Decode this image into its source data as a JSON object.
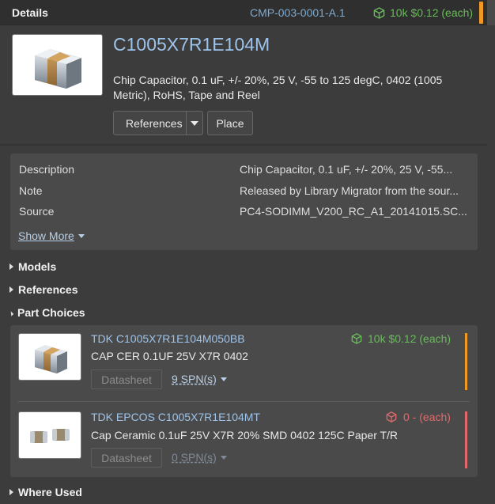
{
  "header": {
    "title": "Details",
    "part_number": "CMP-003-0001-A.1",
    "stock": "10k  $0.12 (each)"
  },
  "part": {
    "name": "C1005X7R1E104M",
    "description": "Chip Capacitor, 0.1 uF, +/- 20%, 25 V, -55 to 125 degC, 0402 (1005 Metric), RoHS, Tape and Reel",
    "references_label": "References",
    "place_label": "Place"
  },
  "properties": [
    {
      "key": "Description",
      "value": "Chip Capacitor, 0.1 uF, +/- 20%, 25 V, -55..."
    },
    {
      "key": "Note",
      "value": "Released by Library Migrator from the sour..."
    },
    {
      "key": "Source",
      "value": "PC4-SODIMM_V200_RC_A1_20141015.SC..."
    }
  ],
  "show_more_label": "Show More",
  "sections": {
    "models": "Models",
    "references": "References",
    "part_choices": "Part Choices",
    "where_used": "Where Used"
  },
  "part_choices": [
    {
      "name": "TDK C1005X7R1E104M050BB",
      "description": "CAP CER 0.1UF 25V X7R 0402",
      "stock": "10k  $0.12 (each)",
      "stock_color": "#6aba5b",
      "accent_color": "#f09a23",
      "datasheet_label": "Datasheet",
      "spn_label": "9 SPN(s)"
    },
    {
      "name": "TDK EPCOS C1005X7R1E104MT",
      "description": "Cap Ceramic 0.1uF 25V X7R 20% SMD 0402 125C Paper T/R",
      "stock": "0  - (each)",
      "stock_color": "#e06a6a",
      "accent_color": "#e06a6a",
      "datasheet_label": "Datasheet",
      "spn_label": "0 SPN(s)"
    }
  ],
  "icons": {
    "header_stock": "cube-icon",
    "part_image": "capacitor-chip-image",
    "expand": "chevron-right-icon",
    "collapse": "chevron-down-icon",
    "dropdown": "caret-down-icon"
  },
  "colors": {
    "accent_link": "#9ec3ea",
    "stock_ok": "#6aba5b",
    "stock_none": "#e06a6a",
    "warning_bar": "#f09a23"
  }
}
